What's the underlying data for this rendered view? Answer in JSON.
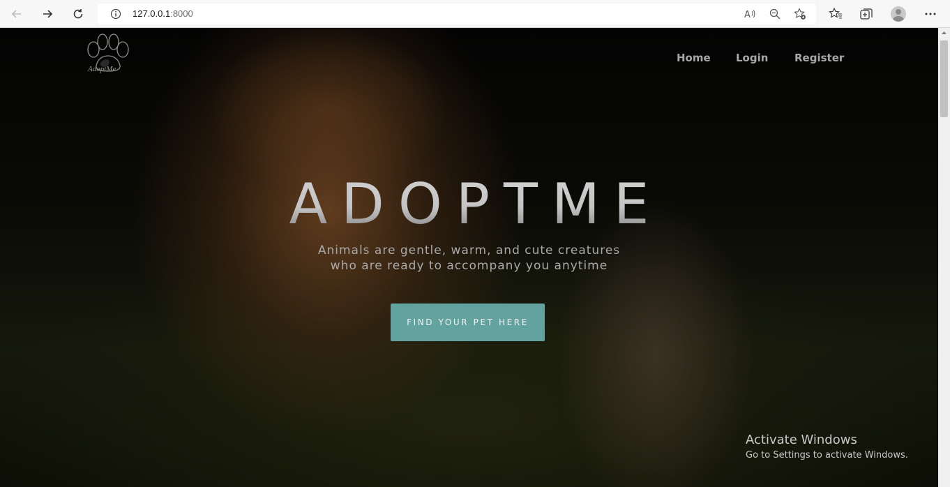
{
  "browser": {
    "url_host": "127.0.0.1",
    "url_port": ":8000"
  },
  "site": {
    "logo_text": "AdoptMe",
    "nav": [
      "Home",
      "Login",
      "Register"
    ]
  },
  "hero": {
    "title": "ADOPTME",
    "subtitle_line1": "Animals are gentle, warm, and cute creatures",
    "subtitle_line2": "who are ready to accompany you anytime",
    "cta_label": "FIND YOUR PET HERE",
    "cta_color": "#63a39f"
  },
  "watermark": {
    "title": "Activate Windows",
    "subtitle": "Go to Settings to activate Windows."
  },
  "icons": [
    "back-icon",
    "forward-icon",
    "refresh-icon",
    "info-icon",
    "read-aloud-icon",
    "zoom-icon",
    "add-favorite-icon",
    "favorites-icon",
    "collections-icon",
    "profile-avatar",
    "more-icon"
  ]
}
